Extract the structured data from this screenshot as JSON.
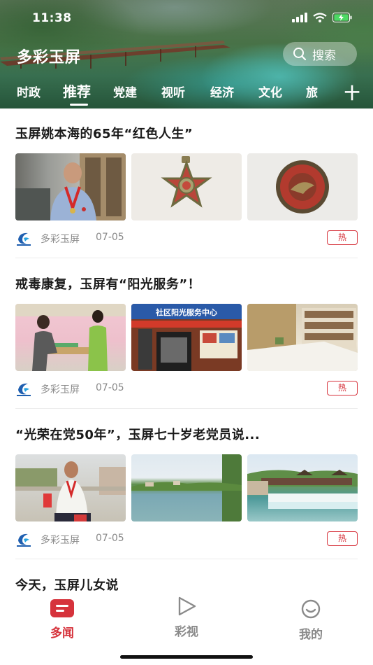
{
  "status_bar": {
    "time": "11:38"
  },
  "header": {
    "app_title": "多彩玉屏",
    "search_label": "搜索",
    "tabs": [
      {
        "label": "时政"
      },
      {
        "label": "推荐"
      },
      {
        "label": "党建"
      },
      {
        "label": "视听"
      },
      {
        "label": "经济"
      },
      {
        "label": "文化"
      },
      {
        "label": "旅"
      }
    ],
    "add_tab_label": "十",
    "active_tab_index": 1
  },
  "articles": [
    {
      "title": "玉屏姚本海的65年“红色人生”",
      "source": "多彩玉屏",
      "date": "07-05",
      "badge": "热",
      "thumbnails": [
        "veteran-with-medal-photo",
        "red-star-medal-photo",
        "round-medal-photo"
      ]
    },
    {
      "title": "戒毒康复，玉屏有“阳光服务”！",
      "source": "多彩玉屏",
      "date": "07-05",
      "badge": "热",
      "thumbnails": [
        "counseling-session-photo",
        "sunshine-service-center-photo",
        "meeting-room-photo"
      ],
      "sign_text": "社区阳光服务中心"
    },
    {
      "title": "“光荣在党50年”，玉屏七十岁老党员说...",
      "source": "多彩玉屏",
      "date": "07-05",
      "badge": "热",
      "thumbnails": [
        "elder-party-member-photo",
        "river-landscape-photo",
        "wind-rain-bridge-photo"
      ]
    },
    {
      "title": "今天，玉屏儿女说"
    }
  ],
  "bottom_nav": {
    "items": [
      {
        "label": "多闻",
        "icon": "news-icon",
        "active": true
      },
      {
        "label": "彩视",
        "icon": "play-icon",
        "active": false
      },
      {
        "label": "我的",
        "icon": "profile-icon",
        "active": false
      }
    ]
  },
  "colors": {
    "accent": "#d6333c",
    "inactive": "#8a8a8a"
  }
}
